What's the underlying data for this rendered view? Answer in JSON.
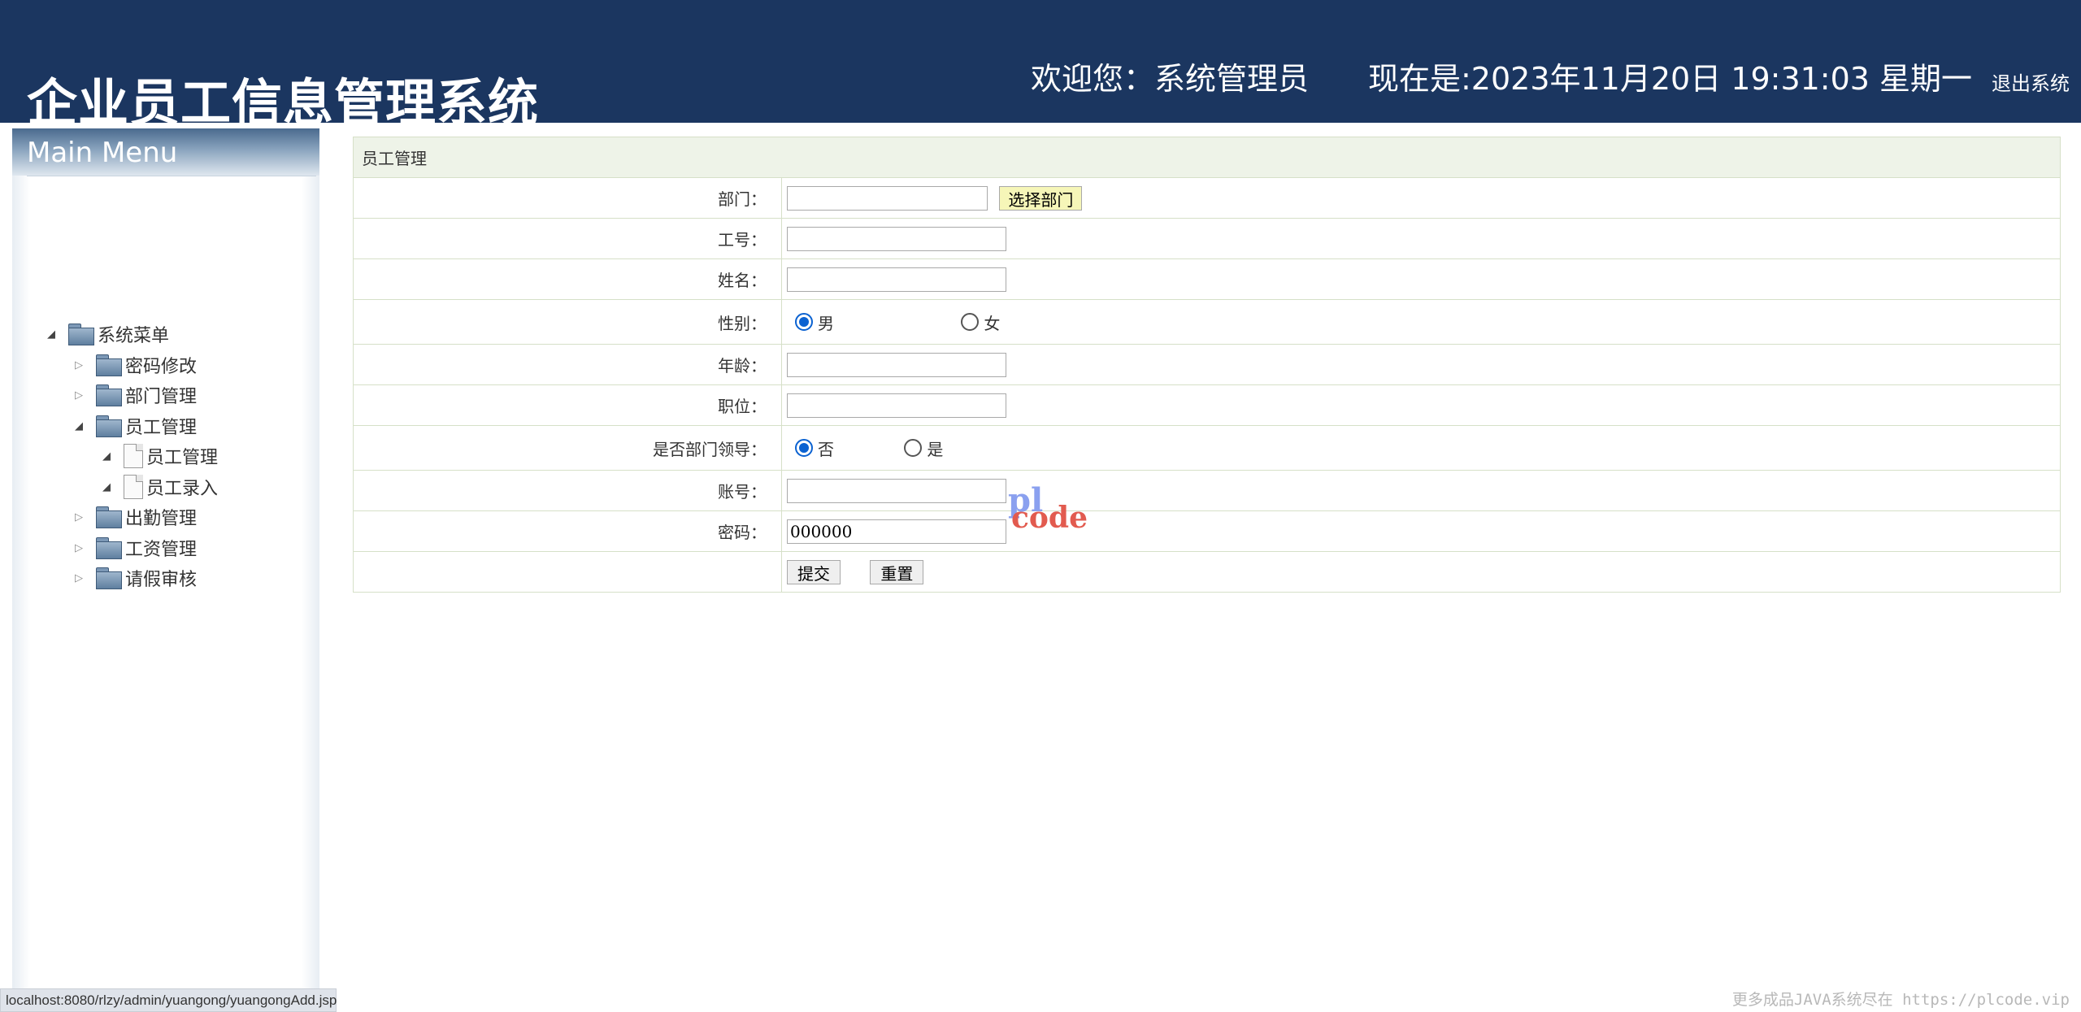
{
  "header": {
    "app_title": "企业员工信息管理系统",
    "welcome": "欢迎您：系统管理员",
    "datetime": "现在是:2023年11月20日 19:31:03 星期一",
    "logout_label": "退出系统"
  },
  "sidebar": {
    "title": "Main Menu",
    "root": "系统菜单",
    "items": [
      {
        "label": "密码修改",
        "expanded": false
      },
      {
        "label": "部门管理",
        "expanded": false
      },
      {
        "label": "员工管理",
        "expanded": true,
        "children": [
          "员工管理",
          "员工录入"
        ]
      },
      {
        "label": "出勤管理",
        "expanded": false
      },
      {
        "label": "工资管理",
        "expanded": false
      },
      {
        "label": "请假审核",
        "expanded": false
      }
    ]
  },
  "form": {
    "caption": "员工管理",
    "department_label": "部门：",
    "department_value": "",
    "select_department_button": "选择部门",
    "employee_no_label": "工号：",
    "employee_no_value": "",
    "name_label": "姓名：",
    "name_value": "",
    "gender_label": "性别：",
    "gender_options": [
      "男",
      "女"
    ],
    "gender_selected": "男",
    "age_label": "年龄：",
    "age_value": "",
    "position_label": "职位：",
    "position_value": "",
    "is_leader_label": "是否部门领导：",
    "is_leader_options": [
      "否",
      "是"
    ],
    "is_leader_selected": "否",
    "account_label": "账号：",
    "account_value": "",
    "password_label": "密码：",
    "password_value": "000000",
    "submit_label": "提交",
    "reset_label": "重置"
  },
  "watermark": {
    "line1": "pl",
    "line2": "code"
  },
  "status_bar": {
    "url": "localhost:8080/rlzy/admin/yuangong/yuangongAdd.jsp"
  },
  "footer_watermark": "更多成品JAVA系统尽在 https://plcode.vip",
  "colors": {
    "header_bg": "#1b3660",
    "caption_bg": "#eef3e8",
    "radio_accent": "#0b62d1"
  }
}
